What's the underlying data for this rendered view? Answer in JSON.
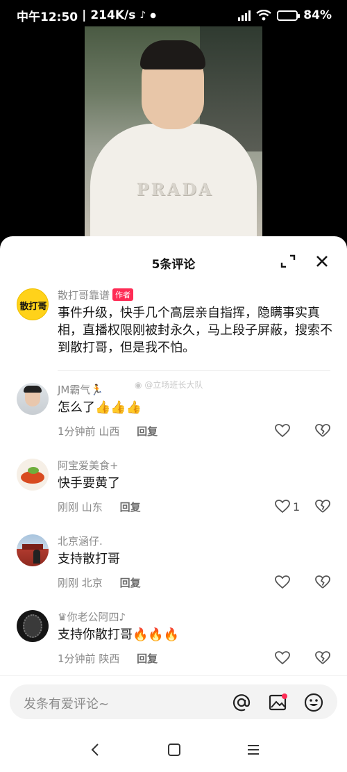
{
  "status_bar": {
    "time": "中午12:50",
    "speed": "214K/s",
    "battery": "84%",
    "battery_level": 0.84
  },
  "sheet": {
    "title": "5条评论"
  },
  "comments": [
    {
      "user": "散打哥靠谱",
      "badge": "作者",
      "text": "事件升级，快手几个高层亲自指挥，隐瞒事实真相，直播权限刚被封永久，马上段子屏蔽，搜索不到散打哥，但是我不怕。",
      "avatar_label": "散打哥"
    },
    {
      "user": "JM霸气🏃",
      "text": "怎么了👍👍👍",
      "time": "1分钟前",
      "location": "山西",
      "reply": "回复"
    },
    {
      "user": "阿宝爱美食+",
      "text": "快手要黄了",
      "time": "刚刚",
      "location": "山东",
      "reply": "回复",
      "likes": "1"
    },
    {
      "user": "北京涵仔.",
      "text": "支持散打哥",
      "time": "刚刚",
      "location": "北京",
      "reply": "回复"
    },
    {
      "user": "♛你老公阿四♪",
      "text": "支持你散打哥🔥🔥🔥",
      "time": "1分钟前",
      "location": "陕西",
      "reply": "回复"
    }
  ],
  "watermark": "@立场班长大队",
  "video_shirt_text": "PRADA",
  "input": {
    "placeholder": "发条有爱评论~"
  },
  "colors": {
    "author_badge": "#fe2c55",
    "notification_dot": "#fe2c55"
  }
}
